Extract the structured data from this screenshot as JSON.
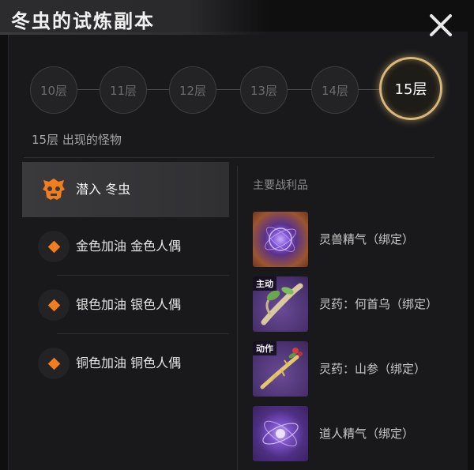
{
  "window": {
    "title": "冬虫的试炼副本"
  },
  "floors": [
    {
      "label": "10层",
      "active": false
    },
    {
      "label": "11层",
      "active": false
    },
    {
      "label": "12层",
      "active": false
    },
    {
      "label": "13层",
      "active": false
    },
    {
      "label": "14层",
      "active": false
    },
    {
      "label": "15层",
      "active": true
    }
  ],
  "section": {
    "monsters_title": "15层 出现的怪物",
    "loot_title": "主要战利品"
  },
  "monsters": [
    {
      "label": "潜入 冬虫",
      "selected": true,
      "icon": "boss-skull-icon"
    },
    {
      "label": "金色加油 金色人偶",
      "selected": false,
      "icon": "diamond-icon"
    },
    {
      "label": "银色加油 银色人偶",
      "selected": false,
      "icon": "diamond-icon"
    },
    {
      "label": "铜色加油 铜色人偶",
      "selected": false,
      "icon": "diamond-icon"
    }
  ],
  "loot": [
    {
      "label": "灵兽精气（绑定）",
      "icon": "purple-orb-icon",
      "tag": ""
    },
    {
      "label": "灵药：何首乌（绑定）",
      "icon": "herb-root-icon",
      "tag": "主动"
    },
    {
      "label": "灵药：山参（绑定）",
      "icon": "ginseng-icon",
      "tag": "动作"
    },
    {
      "label": "道人精气（绑定）",
      "icon": "purple-energy-icon",
      "tag": ""
    }
  ],
  "colors": {
    "accent_gold": "#d8b77a",
    "accent_orange": "#f07d1e",
    "loot_bg_purple": "#5b3f86",
    "loot_bg_orange": "#8b4a2a"
  }
}
